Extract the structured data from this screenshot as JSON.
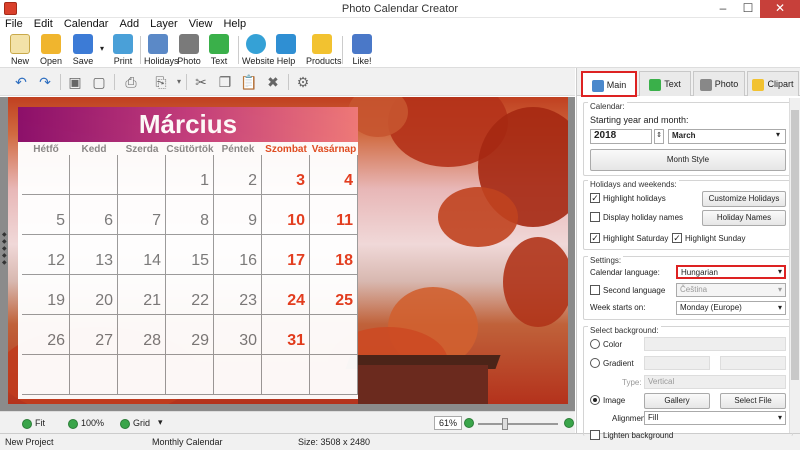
{
  "window": {
    "title": "Photo Calendar Creator",
    "min": "–",
    "max": "☐",
    "close": "✕"
  },
  "menu": [
    "File",
    "Edit",
    "Calendar",
    "Add",
    "Layer",
    "View",
    "Help"
  ],
  "toolbar": [
    {
      "label": "New",
      "color": "#e8c66a"
    },
    {
      "label": "Open",
      "color": "#f0b52e"
    },
    {
      "label": "Save",
      "color": "#3c7bd6"
    },
    {
      "label": "Print",
      "color": "#4aa0d8"
    },
    {
      "label": "Holidays",
      "color": "#5b89c7"
    },
    {
      "label": "Photo",
      "color": "#7a7a7a"
    },
    {
      "label": "Text",
      "color": "#3ab04a"
    },
    {
      "label": "Website",
      "color": "#35a1d6"
    },
    {
      "label": "Help",
      "color": "#2f8fd3"
    },
    {
      "label": "Products",
      "color": "#f2c230"
    },
    {
      "label": "Like!",
      "color": "#4a78c8"
    }
  ],
  "toolbar2_icons": [
    "undo-icon",
    "redo-icon",
    "page-icon",
    "page2-icon",
    "print-preview-icon",
    "export-icon",
    "cut-icon",
    "copy-icon",
    "paste-icon",
    "delete-icon",
    "settings-icon"
  ],
  "calendar": {
    "month": "Március",
    "weekdays": [
      "Hétfő",
      "Kedd",
      "Szerda",
      "Csütörtök",
      "Péntek",
      "Szombat",
      "Vasárnap"
    ],
    "rows": [
      [
        "",
        "",
        "",
        "1",
        "2",
        "3",
        "4"
      ],
      [
        "5",
        "6",
        "7",
        "8",
        "9",
        "10",
        "11"
      ],
      [
        "12",
        "13",
        "14",
        "15",
        "16",
        "17",
        "18"
      ],
      [
        "19",
        "20",
        "21",
        "22",
        "23",
        "24",
        "25"
      ],
      [
        "26",
        "27",
        "28",
        "29",
        "30",
        "31",
        ""
      ],
      [
        "",
        "",
        "",
        "",
        "",
        "",
        ""
      ]
    ],
    "holiday_date": "15",
    "accent": "#e3391a"
  },
  "view": {
    "fit": "Fit",
    "zoom100": "100%",
    "grid": "Grid",
    "zoom_value": "61%",
    "grid_arrow": "▾"
  },
  "status": {
    "project": "New Project",
    "type": "Monthly Calendar",
    "size": "Size: 3508 x 2480"
  },
  "tabs": [
    "Main",
    "Text",
    "Photo",
    "Clipart"
  ],
  "panel": {
    "calendar_section": "Calendar:",
    "starting_label": "Starting year and month:",
    "year": "2018",
    "month": "March",
    "month_style": "Month Style",
    "holidays_section": "Holidays and weekends:",
    "highlight_holidays": "Highlight holidays",
    "customize_holidays": "Customize Holidays",
    "display_holiday_names": "Display holiday names",
    "holiday_names": "Holiday Names",
    "highlight_saturday": "Highlight Saturday",
    "highlight_sunday": "Highlight Sunday",
    "settings_section": "Settings:",
    "calendar_language_label": "Calendar language:",
    "calendar_language": "Hungarian",
    "second_language_label": "Second language",
    "second_language": "Čeština",
    "week_starts_label": "Week starts on:",
    "week_starts": "Monday (Europe)",
    "background_section": "Select background:",
    "color_label": "Color",
    "gradient_label": "Gradient",
    "type_label": "Type:",
    "type_value": "Vertical",
    "image_label": "Image",
    "gallery": "Gallery",
    "select_file": "Select File",
    "alignment_label": "Alignment:",
    "alignment_value": "Fill",
    "lighten_background": "Lighten background"
  },
  "colors": {
    "highlight_border": "#dd2222",
    "sunday": "#e3391a"
  }
}
